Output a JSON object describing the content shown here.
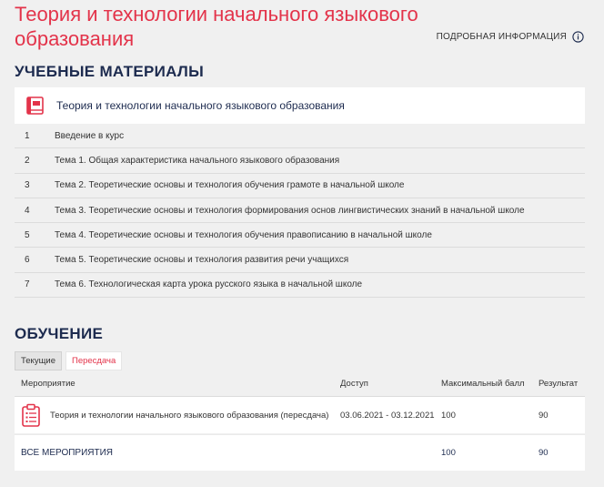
{
  "header": {
    "title": "Теория и технологии начального языкового образования",
    "info_label": "ПОДРОБНАЯ ИНФОРМАЦИЯ"
  },
  "materials": {
    "section_title": "УЧЕБНЫЕ МАТЕРИАЛЫ",
    "course_title": "Теория и технологии начального языкового образования",
    "topics": [
      {
        "num": "1",
        "label": "Введение в курс"
      },
      {
        "num": "2",
        "label": "Тема 1. Общая характеристика начального языкового образования"
      },
      {
        "num": "3",
        "label": "Тема 2. Теоретические основы и технология обучения грамоте в начальной школе"
      },
      {
        "num": "4",
        "label": "Тема 3. Теоретические основы и технология формирования основ лингвистических знаний в начальной школе"
      },
      {
        "num": "5",
        "label": "Тема 4. Теоретические основы и технология обучения правописанию в начальной школе"
      },
      {
        "num": "6",
        "label": "Тема 5. Теоретические основы и технология развития речи учащихся"
      },
      {
        "num": "7",
        "label": "Тема 6. Технологическая карта урока русского языка в начальной школе"
      }
    ]
  },
  "learning": {
    "section_title": "ОБУЧЕНИЕ",
    "tabs": [
      {
        "label": "Текущие",
        "active": true
      },
      {
        "label": "Пересдача",
        "active": false
      }
    ],
    "columns": {
      "event": "Мероприятие",
      "access": "Доступ",
      "max_score": "Максимальный балл",
      "result": "Результат"
    },
    "rows": [
      {
        "event": "Теория и технологии начального языкового образования (пересдача)",
        "access": "03.06.2021 - 03.12.2021",
        "max_score": "100",
        "result": "90"
      }
    ],
    "total": {
      "label": "ВСЕ МЕРОПРИЯТИЯ",
      "max_score": "100",
      "result": "90"
    }
  },
  "colors": {
    "accent": "#e3334a",
    "heading": "#1d2b4f",
    "background": "#f0f0f0"
  },
  "icons": [
    "info-icon",
    "book-icon",
    "clipboard-icon"
  ]
}
